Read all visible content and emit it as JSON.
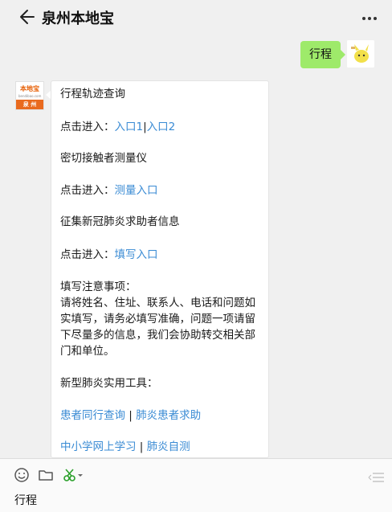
{
  "header": {
    "title": "泉州本地宝"
  },
  "user_message": {
    "text": "行程"
  },
  "bot": {
    "avatar": {
      "logo_text": "本地宝",
      "site_text": "bendibao.com",
      "city_text": "泉 州"
    },
    "lines": {
      "l1": "行程轨迹查询",
      "l2_prefix": "点击进入：",
      "l2_link1": "入口1",
      "l2_sep": "|",
      "l2_link2": "入口2",
      "l3": "密切接触者测量仪",
      "l4_prefix": "点击进入：",
      "l4_link": "测量入口",
      "l5": "征集新冠肺炎求助者信息",
      "l6_prefix": "点击进入：",
      "l6_link": "填写入口",
      "l7": "填写注意事项：",
      "l8": "请将姓名、住址、联系人、电话和问题如",
      "l9": "实填写，请务必填写准确，问题一项请留",
      "l10": "下尽量多的信息，我们会协助转交相关部",
      "l11": "门和单位。",
      "l12": "新型肺炎实用工具：",
      "l13_link1": "患者同行查询",
      "l13_sep": " | ",
      "l13_link2": "肺炎患者求助",
      "l14_link1": "中小学网上学习",
      "l14_sep": " | ",
      "l14_link2": "肺炎自测"
    }
  },
  "input": {
    "value": "行程"
  },
  "colors": {
    "link": "#3a8bd4",
    "user_bubble": "#9eea6a",
    "brand_orange": "#e96a1e"
  }
}
